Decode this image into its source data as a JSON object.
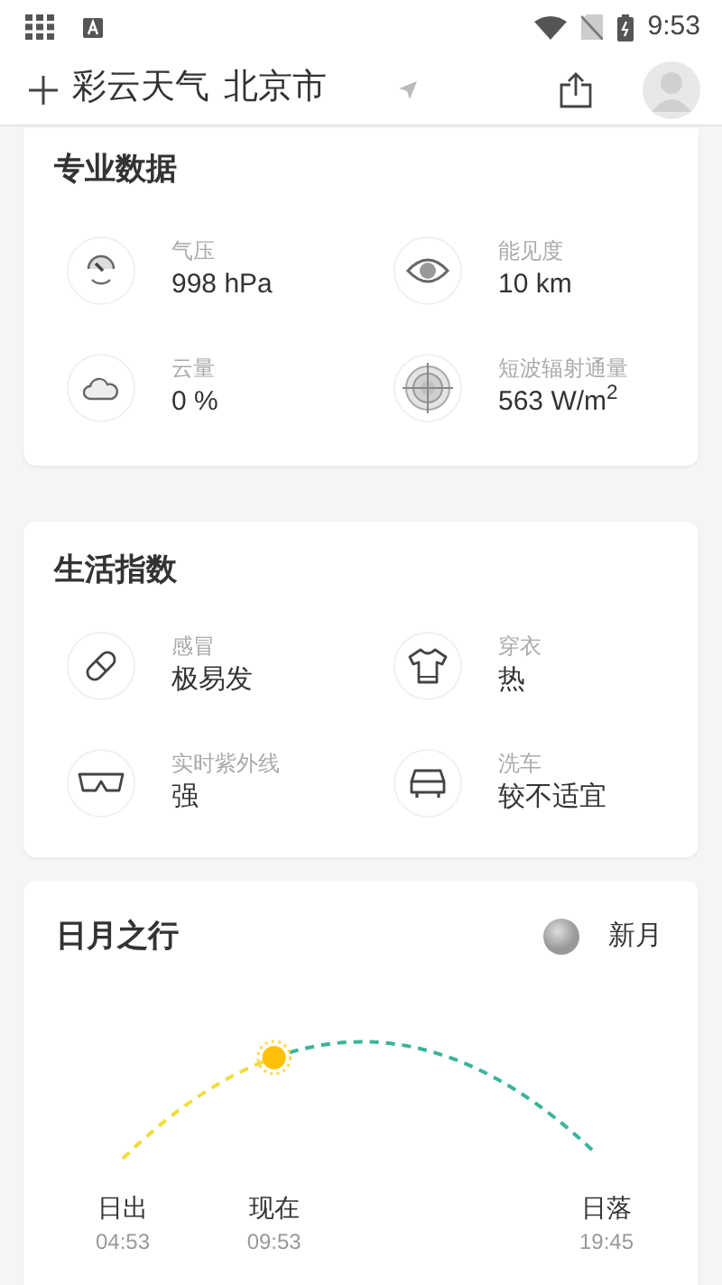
{
  "status_bar": {
    "time": "9:53"
  },
  "header": {
    "app_name": "彩云天气",
    "city": "北京市"
  },
  "pro_data": {
    "title": "专业数据",
    "items": [
      {
        "kind": "pressure",
        "label": "气压",
        "value": "998 hPa"
      },
      {
        "kind": "visibility",
        "label": "能见度",
        "value": "10 km"
      },
      {
        "kind": "cloud",
        "label": "云量",
        "value": "0 %"
      },
      {
        "kind": "radiation",
        "label": "短波辐射通量",
        "value": "563 W/m$^{2}$"
      }
    ]
  },
  "life_index": {
    "title": "生活指数",
    "items": [
      {
        "kind": "flu",
        "label": "感冒",
        "value": "极易发"
      },
      {
        "kind": "clothing",
        "label": "穿衣",
        "value": "热"
      },
      {
        "kind": "uv",
        "label": "实时紫外线",
        "value": "强"
      },
      {
        "kind": "carwash",
        "label": "洗车",
        "value": "较不适宜"
      }
    ]
  },
  "sun_moon": {
    "title": "日月之行",
    "moon_phase": "新月",
    "level": 0.32,
    "points": [
      {
        "kind": "sunrise",
        "label": "日出",
        "time": "04:53"
      },
      {
        "kind": "now",
        "label": "现在",
        "time": "09:53"
      },
      {
        "kind": "sunset",
        "label": "日落",
        "time": "19:45"
      }
    ]
  }
}
